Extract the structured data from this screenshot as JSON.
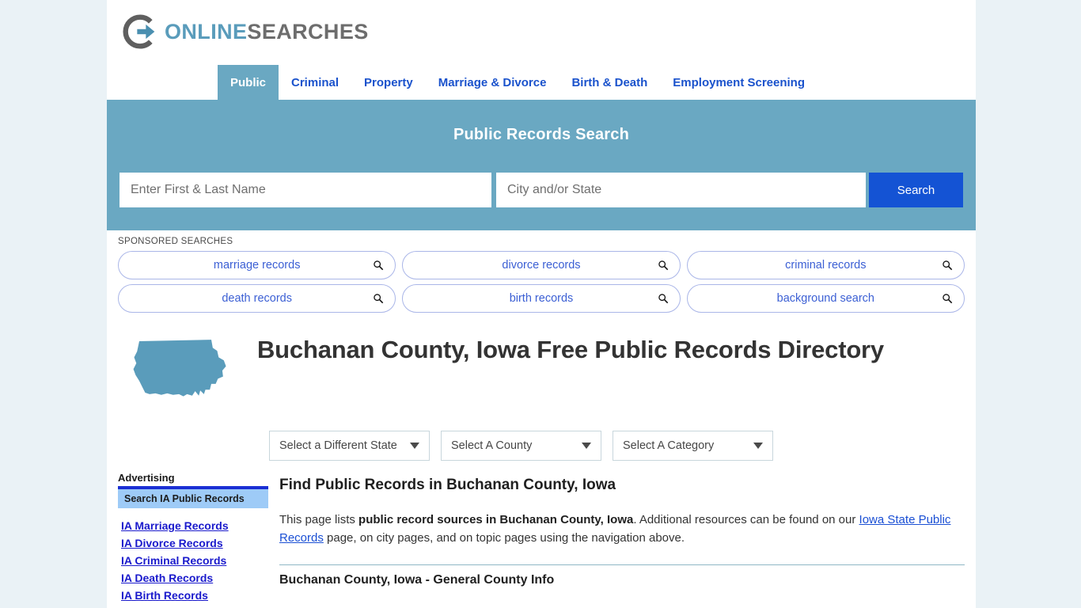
{
  "brand": {
    "name_part1": "ONLINE",
    "name_part2": "SEARCHES",
    "logo_icon": "circle-arrow-icon",
    "accent_color": "#5a9cbb",
    "gray_color": "#6d6d6d"
  },
  "nav": {
    "items": [
      {
        "label": "Public",
        "active": true
      },
      {
        "label": "Criminal",
        "active": false
      },
      {
        "label": "Property",
        "active": false
      },
      {
        "label": "Marriage & Divorce",
        "active": false
      },
      {
        "label": "Birth & Death",
        "active": false
      },
      {
        "label": "Employment Screening",
        "active": false
      }
    ],
    "link_color": "#1a52cc",
    "active_bg": "#6aa8c2"
  },
  "search": {
    "heading": "Public Records Search",
    "name_placeholder": "Enter First & Last Name",
    "name_value": "",
    "city_placeholder": "City and/or State",
    "city_value": "",
    "button_label": "Search",
    "banner_color": "#6aa8c2",
    "button_color": "#1453d4"
  },
  "sponsored": {
    "label": "SPONSORED SEARCHES",
    "chips": [
      {
        "label": "marriage records",
        "icon": "search-icon"
      },
      {
        "label": "divorce records",
        "icon": "search-icon"
      },
      {
        "label": "criminal records",
        "icon": "search-icon"
      },
      {
        "label": "death records",
        "icon": "search-icon"
      },
      {
        "label": "birth records",
        "icon": "search-icon"
      },
      {
        "label": "background search",
        "icon": "search-icon"
      }
    ]
  },
  "page": {
    "title": "Buchanan County, Iowa Free Public Records Directory",
    "state_map_icon": "iowa-state-map-icon",
    "state_map_color": "#5a9cbb"
  },
  "selects": [
    {
      "label": "Select a Different State",
      "name": "state-select"
    },
    {
      "label": "Select A County",
      "name": "county-select"
    },
    {
      "label": "Select A Category",
      "name": "category-select"
    }
  ],
  "sidebar": {
    "advertising_label": "Advertising",
    "ad_box_label": "Search IA Public Records",
    "links": [
      "IA Marriage Records",
      "IA Divorce Records",
      "IA Criminal Records",
      "IA Death Records",
      "IA Birth Records"
    ]
  },
  "main": {
    "section_heading": "Find Public Records in Buchanan County, Iowa",
    "intro_prefix": "This page lists ",
    "intro_bold": "public record sources in Buchanan County, Iowa",
    "intro_middle": ". Additional resources can be found on our ",
    "intro_link": "Iowa State Public Records",
    "intro_suffix": " page, on city pages, and on topic pages using the navigation above.",
    "subsection_heading": "Buchanan County, Iowa - General County Info"
  }
}
